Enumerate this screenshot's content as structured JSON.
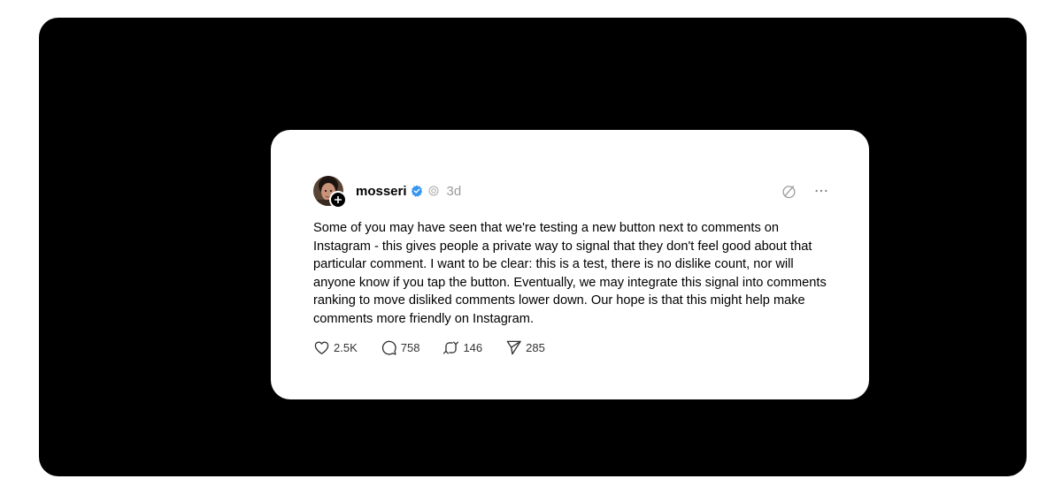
{
  "post": {
    "username": "mosseri",
    "time": "3d",
    "body": "Some of you may have seen that we're testing a new button next to comments on Instagram - this gives people a private way to signal that they don't feel good about that particular comment. I want to be clear: this is a test, there is no dislike count, nor will anyone know if you tap the button. Eventually, we may integrate this signal into comments ranking to move disliked comments lower down. Our hope is that this might help make comments more friendly on Instagram.",
    "verified_color": "#3797f0",
    "icons": {
      "avatar": "avatar",
      "follow": "plus-icon",
      "verified": "verified-badge-icon",
      "threads": "threads-icon",
      "hide": "hide-icon",
      "more": "more-icon"
    }
  },
  "actions": {
    "likes": "2.5K",
    "replies": "758",
    "reposts": "146",
    "shares": "285"
  }
}
